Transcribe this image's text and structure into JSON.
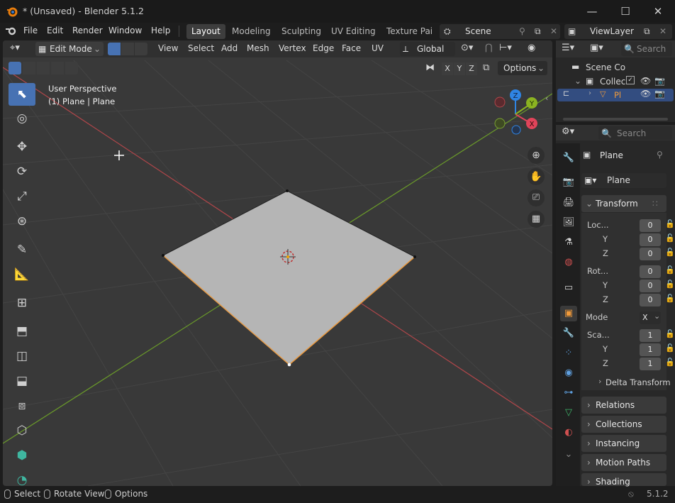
{
  "window": {
    "title": "* (Unsaved) - Blender 5.1.2",
    "minimize": "—",
    "maximize": "☐",
    "close": "✕"
  },
  "menu": {
    "items": [
      "File",
      "Edit",
      "Render",
      "Window",
      "Help"
    ]
  },
  "workspaces": {
    "tabs": [
      "Layout",
      "Modeling",
      "Sculpting",
      "UV Editing",
      "Texture Pai"
    ],
    "active": "Layout"
  },
  "scene": {
    "name": "Scene",
    "view_layer": "ViewLayer"
  },
  "viewport": {
    "mode": "Edit Mode",
    "menus": [
      "View",
      "Select",
      "Add",
      "Mesh",
      "Vertex",
      "Edge",
      "Face",
      "UV"
    ],
    "transform_orientation": "Global",
    "axes": [
      "X",
      "Y",
      "Z"
    ],
    "options_label": "Options",
    "info_line1": "User Perspective",
    "info_line2": "(1) Plane | Plane",
    "gizmo": {
      "x": "X",
      "y": "Y",
      "z": "Z",
      "x_color": "#e0445a",
      "y_color": "#8bb321",
      "z_color": "#2f84e3"
    }
  },
  "toolbar": {
    "tools": [
      "select-box",
      "cursor",
      "move",
      "rotate",
      "scale",
      "transform",
      "annotate",
      "measure",
      "add-cube",
      "extrude",
      "inset",
      "bevel",
      "loop-cut",
      "knife",
      "poly-build",
      "spin"
    ]
  },
  "outliner": {
    "search_placeholder": "Search",
    "scene_collection": "Scene Co",
    "collection": "Collec",
    "object": "Pl"
  },
  "properties": {
    "search_placeholder": "Search",
    "object_name": "Plane",
    "data_name": "Plane",
    "transform_label": "Transform",
    "location_label": "Loc...",
    "rotation_label": "Rot...",
    "scale_label": "Sca...",
    "y_label": "Y",
    "z_label": "Z",
    "location": [
      "0",
      "0",
      "0"
    ],
    "rotation": [
      "0",
      "0",
      "0"
    ],
    "mode_label": "Mode",
    "mode_value": "X",
    "scale": [
      "1",
      "1",
      "1"
    ],
    "delta_label": "Delta Transform",
    "panels": [
      "Relations",
      "Collections",
      "Instancing",
      "Motion Paths",
      "Shading"
    ]
  },
  "statusbar": {
    "select": "Select",
    "rotate": "Rotate View",
    "options": "Options",
    "version": "5.1.2"
  },
  "colors": {
    "selection": "#4772b3",
    "edge_selected": "#f09a3a",
    "plane": "#b5b5b5",
    "x_axis": "#c9494c",
    "y_axis": "#6a9a2a"
  }
}
